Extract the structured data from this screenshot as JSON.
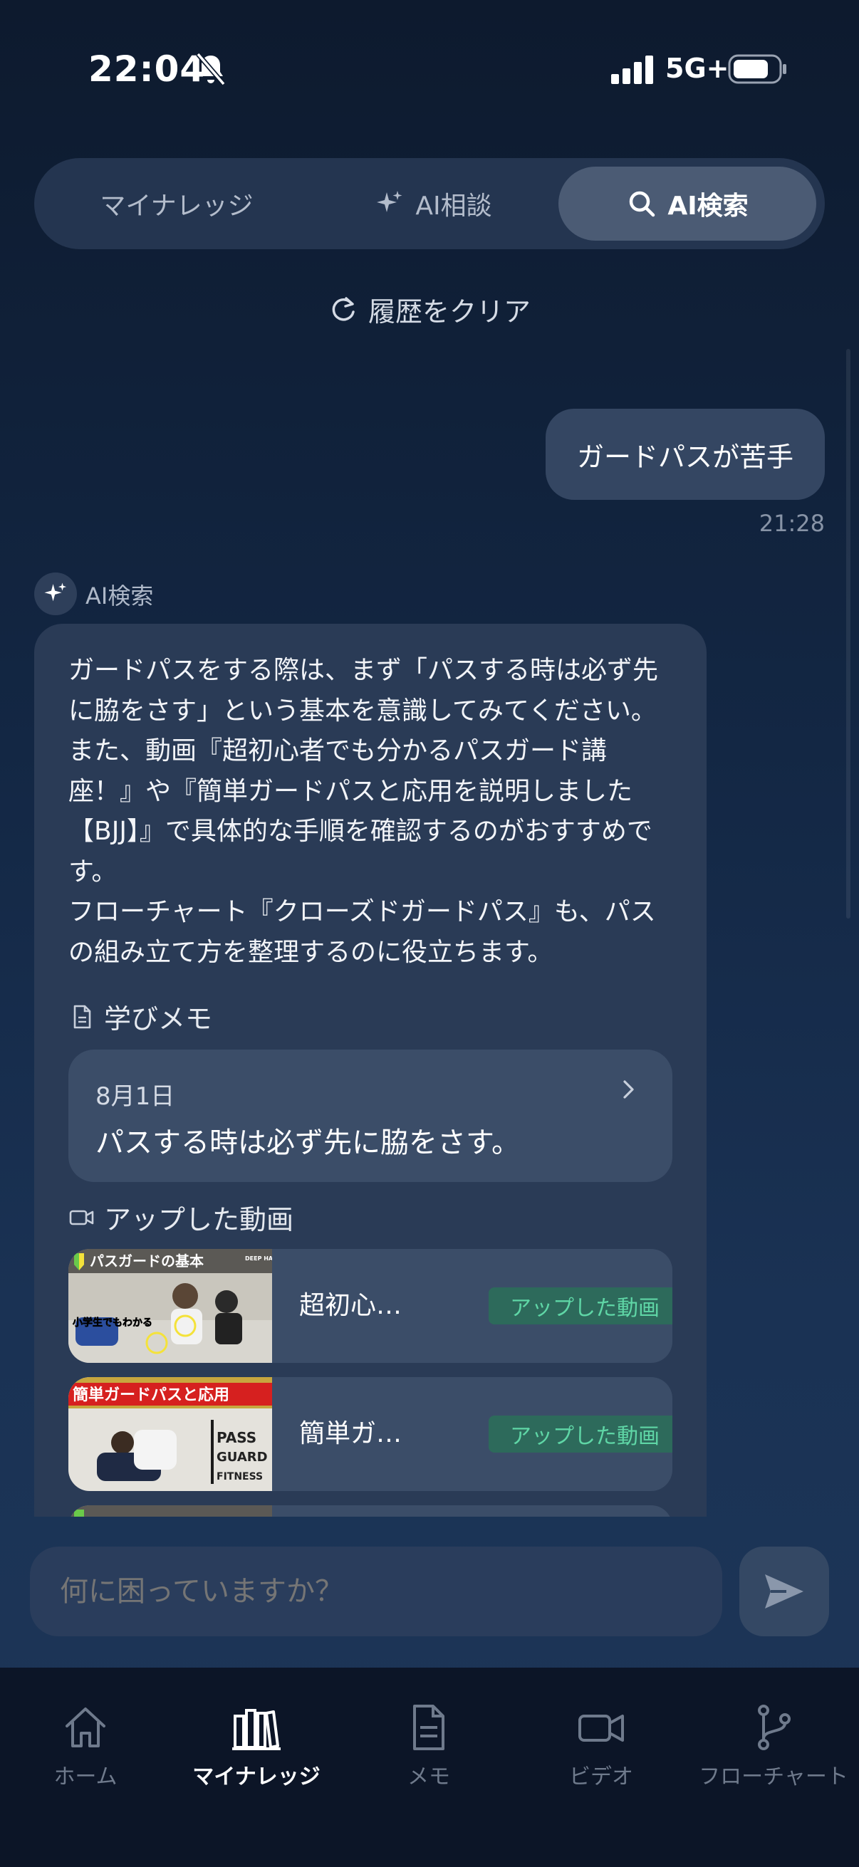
{
  "status_bar": {
    "time": "22:04",
    "network": "5G+"
  },
  "segment": {
    "tabs": [
      {
        "label": "マイナレッジ"
      },
      {
        "label": "AI相談"
      },
      {
        "label": "AI検索"
      }
    ],
    "active_index": 2
  },
  "clear_history_label": "履歴をクリア",
  "user_message": {
    "text": "ガードパスが苦手",
    "time": "21:28"
  },
  "ai_message": {
    "sender": "AI検索",
    "text": "ガードパスをする際は、まず「パスする時は必ず先\nに脇をさす」という基本を意識してみてください。\nまた、動画『超初心者でも分かるパスガード講\n座！』や『簡単ガードパスと応用を説明しました\n【BJJ】』で具体的な手順を確認するのがおすすめで\nす。\nフローチャート『クローズドガードパス』も、パス\nの組み立て方を整理するのに役立ちます。",
    "memo_section": {
      "heading": "学びメモ",
      "date": "8月1日",
      "text": "パスする時は必ず先に脇をさす。"
    },
    "video_section": {
      "heading": "アップした動画",
      "videos": [
        {
          "title": "超初心…",
          "badge": "アップした動画",
          "thumb_caption": "パスガードの基本",
          "thumb_sub": "小学生でもわかる",
          "thumb_logo": "DEEP HALF CLUB"
        },
        {
          "title": "簡単ガ…",
          "badge": "アップした動画",
          "thumb_caption": "簡単ガードパスと応用",
          "thumb_sub": "PASS GUARD FITNESS"
        }
      ]
    }
  },
  "input": {
    "placeholder": "何に困っていますか？"
  },
  "bottom_nav": {
    "items": [
      {
        "label": "ホーム",
        "icon": "home-icon"
      },
      {
        "label": "マイナレッジ",
        "icon": "library-icon"
      },
      {
        "label": "メモ",
        "icon": "memo-icon"
      },
      {
        "label": "ビデオ",
        "icon": "video-icon"
      },
      {
        "label": "フローチャート",
        "icon": "branch-icon"
      }
    ],
    "active_index": 1
  }
}
